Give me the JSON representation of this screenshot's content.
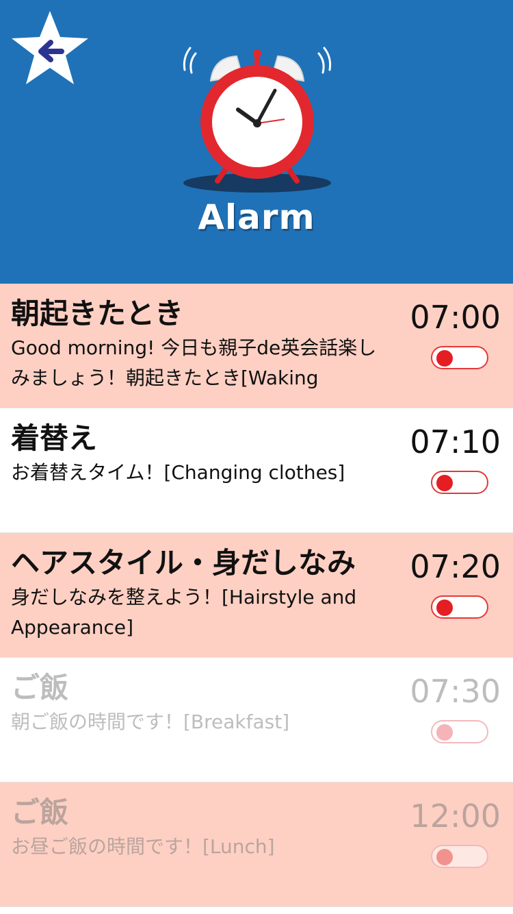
{
  "header": {
    "title": "Alarm",
    "back_icon": "back-arrow-star-icon",
    "clock_icon": "alarm-clock-icon",
    "colors": {
      "background": "#1f72b8",
      "row_pink": "#fdd0c3",
      "toggle_red": "#e51e24"
    }
  },
  "alarms": [
    {
      "title": "朝起きたとき",
      "description": "Good morning! 今日も親子de英会話楽しみましょう！朝起きたとき[Waking",
      "time": "07:00",
      "enabled": true
    },
    {
      "title": "着替え",
      "description": "お着替えタイム！[Changing clothes]",
      "time": "07:10",
      "enabled": true
    },
    {
      "title": "ヘアスタイル・身だしなみ",
      "description": "身だしなみを整えよう！[Hairstyle and Appearance]",
      "time": "07:20",
      "enabled": true
    },
    {
      "title": "ご飯",
      "description": "朝ご飯の時間です！[Breakfast]",
      "time": "07:30",
      "enabled": false
    },
    {
      "title": "ご飯",
      "description": "お昼ご飯の時間です！[Lunch]",
      "time": "12:00",
      "enabled": false
    }
  ]
}
